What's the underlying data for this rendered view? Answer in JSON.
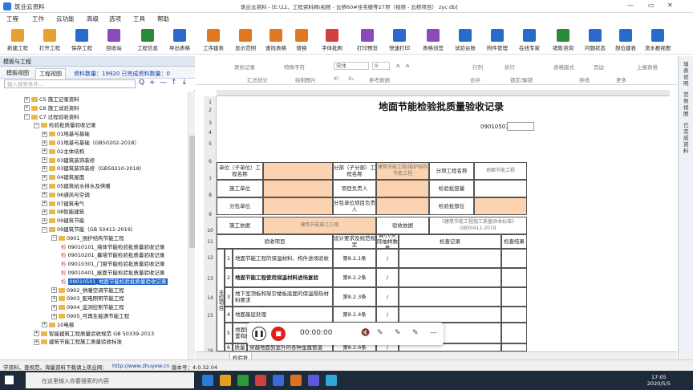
{
  "window": {
    "app_name": "筑业云资料",
    "title": "筑业云资料 - [E:\\12、工程资料网\\视频 - 云桥60#住宅楼等27项（视频 - 云桥项目） zyc db]",
    "controls": [
      "—",
      "▭",
      "✕"
    ],
    "extra_controls": [
      "▭",
      "⧉",
      "✕"
    ]
  },
  "menu": [
    "工程",
    "工作",
    "云功能",
    "高级",
    "选项",
    "工具",
    "帮助"
  ],
  "ribbon": [
    {
      "label": "新建工程",
      "color": "#e8a030"
    },
    {
      "label": "打开工程",
      "color": "#e8a030"
    },
    {
      "label": "保存工程",
      "color": "#2a6acb"
    },
    {
      "label": "回收站",
      "color": "#8a4abb"
    },
    {
      "label": "工程信息",
      "color": "#2a8a3a"
    },
    {
      "label": "导出表格",
      "color": "#2a6acb"
    },
    {
      "label": "工序建表",
      "color": "#e07820"
    },
    {
      "label": "显示范例",
      "color": "#e07820"
    },
    {
      "label": "查找表格",
      "color": "#e07820"
    },
    {
      "label": "替换",
      "color": "#e07820"
    },
    {
      "label": "字体批刷",
      "color": "#d04040"
    },
    {
      "label": "打印预览",
      "color": "#8a4abb"
    },
    {
      "label": "快速打印",
      "color": "#2a6acb"
    },
    {
      "label": "表格创签",
      "color": "#8a4abb"
    },
    {
      "label": "试验台账",
      "color": "#2a6acb"
    },
    {
      "label": "附件管理",
      "color": "#2a6acb"
    },
    {
      "label": "在线专家",
      "color": "#2a6acb"
    },
    {
      "label": "销售咨询",
      "color": "#2a8a3a"
    },
    {
      "label": "问题状态",
      "color": "#2a6acb"
    },
    {
      "label": "部位建表",
      "color": "#2a6acb"
    },
    {
      "label": "流水报视图",
      "color": "#2a6acb"
    }
  ],
  "left_panel": {
    "header": "模板与工程",
    "tabs": [
      "模板视图",
      "工程视图"
    ],
    "stats": "资料数量：19920  已完成资料数量：0",
    "search_placeholder": "输入搜索条件...",
    "search_controls": [
      "Q",
      "+",
      "—",
      "↑",
      "↓"
    ],
    "tree": [
      {
        "label": "C5 施工记录资料",
        "depth": 0,
        "kind": "folder",
        "expander": "+"
      },
      {
        "label": "C6 施工试验资料",
        "depth": 0,
        "kind": "folder",
        "expander": "+"
      },
      {
        "label": "C7 过程验收资料",
        "depth": 0,
        "kind": "folder",
        "expander": "−"
      },
      {
        "label": "检验批质量验收记录",
        "depth": 1,
        "kind": "folder",
        "expander": "−"
      },
      {
        "label": "01地基与基础",
        "depth": 2,
        "kind": "folder",
        "expander": "+"
      },
      {
        "label": "01地基与基础（GB50202-2018）",
        "depth": 2,
        "kind": "folder",
        "expander": "+"
      },
      {
        "label": "02主体结构",
        "depth": 2,
        "kind": "folder",
        "expander": "+"
      },
      {
        "label": "03建筑装饰装修",
        "depth": 2,
        "kind": "folder",
        "expander": "+"
      },
      {
        "label": "03建筑装饰装修（GB50210-2018）",
        "depth": 2,
        "kind": "folder",
        "expander": "+"
      },
      {
        "label": "04建筑屋面",
        "depth": 2,
        "kind": "folder",
        "expander": "+"
      },
      {
        "label": "05建筑给水排水及供暖",
        "depth": 2,
        "kind": "folder",
        "expander": "+"
      },
      {
        "label": "06通风与空调",
        "depth": 2,
        "kind": "folder",
        "expander": "+"
      },
      {
        "label": "07建筑电气",
        "depth": 2,
        "kind": "folder",
        "expander": "+"
      },
      {
        "label": "08智能建筑",
        "depth": 2,
        "kind": "folder",
        "expander": "+"
      },
      {
        "label": "09建筑节能",
        "depth": 2,
        "kind": "folder",
        "expander": "+"
      },
      {
        "label": "09建筑节能（GB 50411-2019）",
        "depth": 2,
        "kind": "folder",
        "expander": "−"
      },
      {
        "label": "0901_围护结构节能工程",
        "depth": 3,
        "kind": "folder",
        "expander": "−"
      },
      {
        "label": "09010101_墙体节能检验批质量验收记录",
        "depth": 4,
        "kind": "doc",
        "prefix": "检",
        "expander": ""
      },
      {
        "label": "09010201_幕墙节能检验批质量验收记录",
        "depth": 4,
        "kind": "doc",
        "prefix": "检",
        "expander": ""
      },
      {
        "label": "09010301_门窗节能检验批质量验收记录",
        "depth": 4,
        "kind": "doc",
        "prefix": "检",
        "expander": ""
      },
      {
        "label": "09010401_屋面节能检验批质量验收记录",
        "depth": 4,
        "kind": "doc",
        "prefix": "检",
        "expander": ""
      },
      {
        "label": "09010501_地面节能检验批质量验收记录",
        "depth": 4,
        "kind": "doc",
        "prefix": "检",
        "expander": "",
        "selected": true
      },
      {
        "label": "0902_供暖空调节能工程",
        "depth": 3,
        "kind": "folder",
        "expander": "+"
      },
      {
        "label": "0903_配电照明节能工程",
        "depth": 3,
        "kind": "folder",
        "expander": "+"
      },
      {
        "label": "0904_监测控制节能工程",
        "depth": 3,
        "kind": "folder",
        "expander": "+"
      },
      {
        "label": "0905_可再生能源节能工程",
        "depth": 3,
        "kind": "folder",
        "expander": "+"
      },
      {
        "label": "10电梯",
        "depth": 2,
        "kind": "folder",
        "expander": "+"
      },
      {
        "label": "智能建筑工程质量验收规范 GB 50339-2013",
        "depth": 1,
        "kind": "folder",
        "expander": "+"
      },
      {
        "label": "建筑节能工程施工质量验收标准",
        "depth": 1,
        "kind": "folder",
        "expander": "+"
      }
    ]
  },
  "format_bar": {
    "row1": [
      "原始记录",
      "特殊字符",
      "宋体",
      "9",
      "▾",
      "A",
      "A",
      "行列",
      "折行",
      "上报表格"
    ],
    "row2": [
      "汇总统计",
      "绘制图片",
      "X²",
      "X₂",
      "参考数据",
      "合并",
      "锁定/解锁",
      "排线",
      "更多"
    ],
    "row2_extra": [
      "表格版式",
      "页边"
    ]
  },
  "sheet": {
    "row_numbers": [
      "1",
      "2",
      "3",
      "4",
      "5",
      "6",
      "7",
      "8",
      "9",
      "10",
      "11",
      "12",
      "13",
      "14",
      "15",
      "16"
    ],
    "title": "地面节能检验批质量验收记录",
    "doc_no": "09010501",
    "rows": {
      "unit_project": "单位（子单位）工程名称",
      "sub_project": "分部（子分部）工程名称",
      "sub_project_value": "建筑节能工程/围护结构节能工程",
      "sub_item": "分项工程名称",
      "sub_item_value": "地面节能工程",
      "contractor": "施工单位",
      "project_leader": "项目负责人",
      "batch_capacity": "检验批容量",
      "subcontractor": "分包单位",
      "sub_leader": "分包单位项目负责人",
      "batch_location": "检验批部位",
      "basis": "施工依据",
      "basis_value": "建筑节能施工方案",
      "acceptance_basis": "验收依据",
      "acceptance_basis_value": "《建筑节能工程施工质量验收标准》GB50411-2019",
      "col_item": "验收项目",
      "col_req": "设计要求及规范规定",
      "col_sample": "最小/实际抽样数量",
      "col_record": "检查记录",
      "col_result": "检查结果",
      "main_control": "主控项目"
    },
    "items": [
      {
        "n": "1",
        "text": "地面节能工程的保温材料、构件进场验收",
        "clause": "第8.2.1条",
        "sample": "/",
        "bold": false
      },
      {
        "n": "2",
        "text": "地面节能工程使用保温材料进场复验",
        "clause": "第8.2.2条",
        "sample": "/",
        "bold": true
      },
      {
        "n": "3",
        "text": "地下室顶板和架空楼板底面的保温隔热材料要求",
        "clause": "第8.2.3条",
        "sample": "/",
        "bold": false
      },
      {
        "n": "4",
        "text": "地面基层处理",
        "clause": "第8.2.4条",
        "sample": "/",
        "bold": false
      },
      {
        "n": "5",
        "text": "地面保温层、隔离层、保护层等各层的设置和构造做法",
        "clause": "第8.2.5条",
        "sample": "/",
        "bold": false
      },
      {
        "n": "6",
        "text": "穿越地面到室外的各种金属管道",
        "clause": "第8.2.6条",
        "sample": "/",
        "bold": false
      }
    ],
    "item6_prefix": "6",
    "item6_sublabel": "质量",
    "tab": "检验批"
  },
  "right_rail": [
    "填表说明",
    "范例视图",
    "已完成资料"
  ],
  "recorder": {
    "time": "00:00:00",
    "pause": "❚❚",
    "stop": "■",
    "icons": [
      "🔇",
      "✎",
      "✎",
      "✎",
      "—"
    ]
  },
  "status_bar": {
    "left": "学资料，查规范，海量资料下载请上筑业网：",
    "link": "http://www.zhuyew.cn",
    "version": "版本号：4.0.32.04"
  },
  "taskbar": {
    "search_placeholder": "在这里输入你要搜索的内容",
    "time": "17:05",
    "date": "2020/5/5",
    "icon_colors": [
      "#2a7ad8",
      "#e0a020",
      "#2a9a3a",
      "#d04040",
      "#3a6ad8",
      "#e07020",
      "#5a5ad8",
      "#2aa8d8"
    ]
  }
}
